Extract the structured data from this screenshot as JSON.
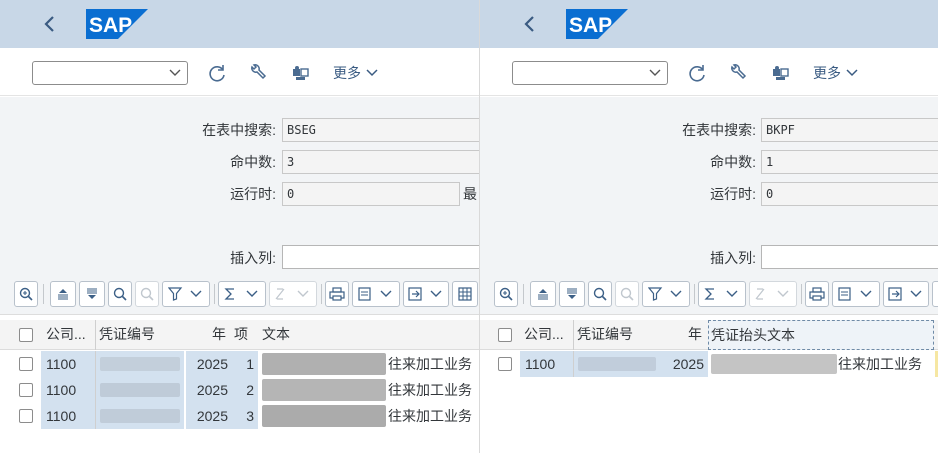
{
  "left_pane": {
    "more_label": "更多",
    "form": {
      "search_table_label": "在表中搜索:",
      "search_table_value": "BSEG",
      "hits_label": "命中数:",
      "hits_value": "3",
      "runtime_label": "运行时:",
      "runtime_value": "0",
      "max_label_clipped": "最",
      "insert_column_label": "插入列:",
      "insert_column_value": ""
    },
    "table": {
      "columns": [
        "公司...",
        "凭证编号",
        "年",
        "项",
        "文本"
      ],
      "rows": [
        {
          "company": "1100",
          "doc_no": "",
          "year": "2025",
          "item": "1",
          "text": "往来加工业务"
        },
        {
          "company": "1100",
          "doc_no": "",
          "year": "2025",
          "item": "2",
          "text": "往来加工业务"
        },
        {
          "company": "1100",
          "doc_no": "",
          "year": "2025",
          "item": "3",
          "text": "往来加工业务"
        }
      ]
    }
  },
  "right_pane": {
    "more_label": "更多",
    "form": {
      "search_table_label": "在表中搜索:",
      "search_table_value": "BKPF",
      "hits_label": "命中数:",
      "hits_value": "1",
      "runtime_label": "运行时:",
      "runtime_value": "0",
      "insert_column_label": "插入列:",
      "insert_column_value": ""
    },
    "table": {
      "columns": [
        "公司...",
        "凭证编号",
        "年",
        "凭证抬头文本"
      ],
      "rows": [
        {
          "company": "1100",
          "doc_no": "",
          "year": "2025",
          "text": "往来加工业务"
        }
      ]
    }
  },
  "colors": {
    "shellbar": "#c8d7e7",
    "sap_logo": "#0a6ed1",
    "key_cell": "#d3e1ef",
    "icon": "#3b5f86"
  },
  "icons": {
    "back": "chevron-left-icon",
    "refresh": "refresh-icon",
    "settings": "wrench-icon",
    "puzzle": "puzzle-icon",
    "zoom": "zoom-icon",
    "sort_asc": "sort-ascending-icon",
    "sort_desc": "sort-descending-icon",
    "find": "search-icon",
    "find_next": "find-next-icon",
    "filter": "filter-icon",
    "sum": "sum-icon",
    "subtotal": "subtotal-icon",
    "print": "print-icon",
    "view": "view-icon",
    "export": "export-icon",
    "layout": "layout-icon"
  }
}
